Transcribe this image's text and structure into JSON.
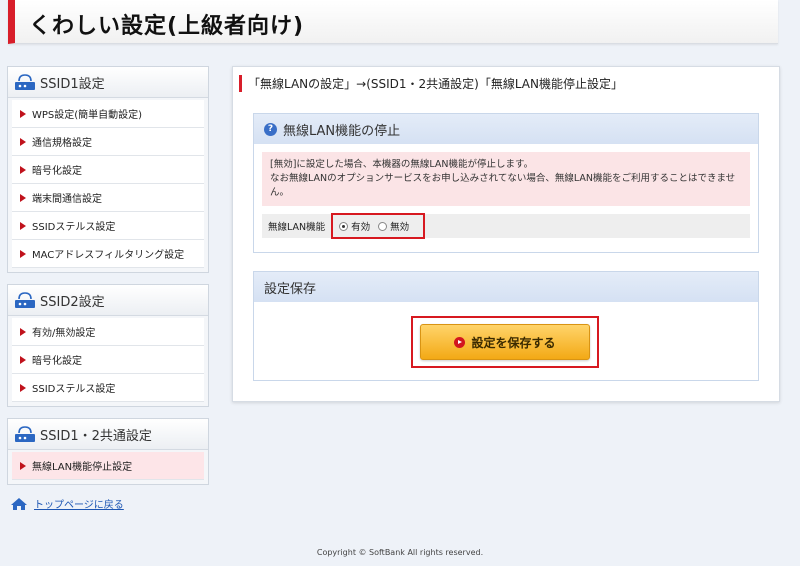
{
  "header": {
    "title": "くわしい設定(上級者向け)"
  },
  "sidebar": {
    "groups": [
      {
        "title": "SSID1設定",
        "items": [
          {
            "label": "WPS設定(簡単自動設定)"
          },
          {
            "label": "通信規格設定"
          },
          {
            "label": "暗号化設定"
          },
          {
            "label": "端末間通信設定"
          },
          {
            "label": "SSIDステルス設定"
          },
          {
            "label": "MACアドレスフィルタリング設定"
          }
        ]
      },
      {
        "title": "SSID2設定",
        "items": [
          {
            "label": "有効/無効設定"
          },
          {
            "label": "暗号化設定"
          },
          {
            "label": "SSIDステルス設定"
          }
        ]
      },
      {
        "title": "SSID1・2共通設定",
        "items": [
          {
            "label": "無線LAN機能停止設定"
          }
        ]
      }
    ],
    "back_link": "トップページに戻る"
  },
  "main": {
    "breadcrumb": "「無線LANの設定」→(SSID1・2共通設定)「無線LAN機能停止設定」",
    "section1": {
      "title": "無線LAN機能の停止",
      "notice_line1": "[無効]に設定した場合、本機器の無線LAN機能が停止します。",
      "notice_line2": "なお無線LANのオプションサービスをお申し込みされてない場合、無線LAN機能をご利用することはできません。",
      "option_label": "無線LAN機能",
      "option_enabled": "有効",
      "option_disabled": "無効",
      "selected": "有効"
    },
    "section2": {
      "title": "設定保存",
      "save_label": "設定を保存する"
    }
  },
  "footer": {
    "copyright": "Copyright © SoftBank All rights reserved."
  },
  "colors": {
    "accent": "#d81e2a",
    "button": "#f3a915",
    "link": "#1d56b3"
  }
}
